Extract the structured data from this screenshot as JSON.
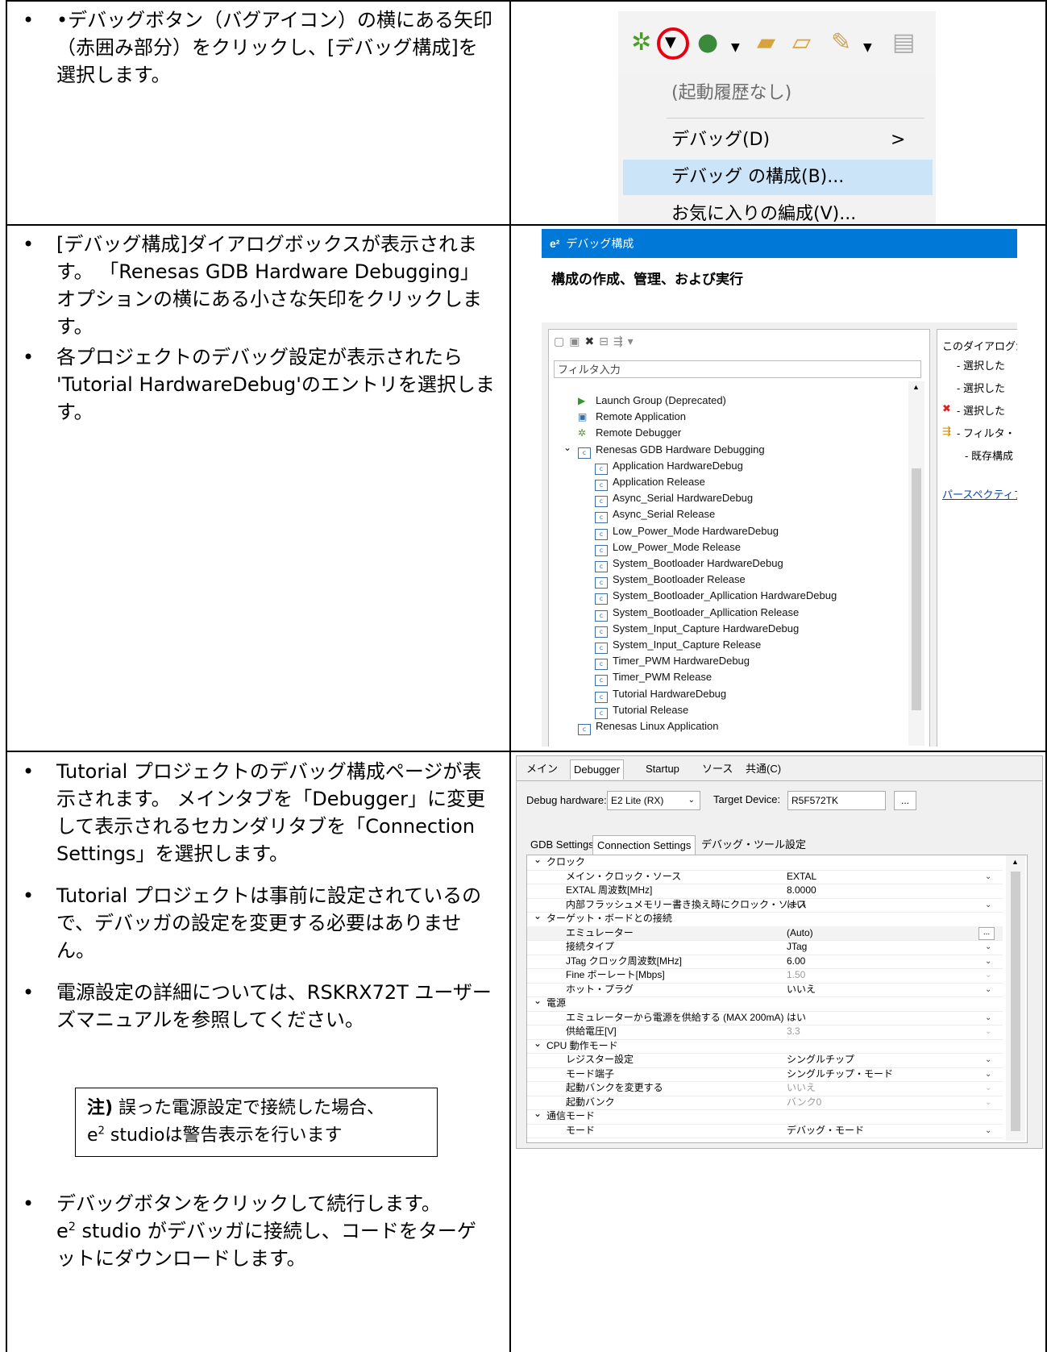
{
  "rows": [
    {
      "bullets": [
        "•デバッグボタン（バグアイコン）の横にある矢印（赤囲み部分）をクリックし、[デバッグ構成]を選択します。"
      ]
    },
    {
      "bullets": [
        "[デバッグ構成]ダイアログボックスが表示されます。 「Renesas GDB Hardware Debugging」オプションの横にある小さな矢印をクリックします。",
        "各プロジェクトのデバッグ設定が表示されたら 'Tutorial HardwareDebug'のエントリを選択します。"
      ]
    },
    {
      "bullets": [
        "Tutorial プロジェクトのデバッグ構成ページが表示されます。 メインタブを「Debugger」に変更して表示されるセカンダリタブを「Connection Settings」を選択します。",
        "Tutorial プロジェクトは事前に設定されているので、デバッガの設定を変更する必要はありません。",
        "電源設定の詳細については、RSKRX72T ユーザーズマニュアルを参照してください。"
      ],
      "note_bold": "注)",
      "note_rest": " 誤った電源設定で接続した場合、",
      "note_line2_pre": "e",
      "note_line2_sup": "2",
      "note_line2_post": " studioは警告表示を行います",
      "last_bullet_line1": "デバッグボタンをクリックして続行します。",
      "last_bullet_pre": "e",
      "last_bullet_sup": "2",
      "last_bullet_post": " studio がデバッガに接続し、コードをターゲットにダウンロードします。"
    }
  ],
  "menu": {
    "items": [
      "(起動履歴なし)",
      "デバッグ(D)",
      "デバッグ の構成(B)...",
      "お気に入りの編成(V)..."
    ],
    "submenu_arrow": ">",
    "highlight_color": "#cce4f7"
  },
  "dialog": {
    "title_prefix": "e²",
    "title": "デバッグ構成",
    "header": "構成の作成、管理、および実行",
    "filter_placeholder": "フィルタ入力",
    "right_pane": [
      "このダイアログか",
      "- 選択した",
      "- 選択した",
      "- 選択した",
      "- フィルタ・",
      "- 既存構成",
      "パースペクティブ"
    ],
    "tree": [
      {
        "label": "Launch Group (Deprecated)",
        "level": 1,
        "icon": "launch-group-icon"
      },
      {
        "label": "Remote Application",
        "level": 1,
        "icon": "remote-app-icon"
      },
      {
        "label": "Remote Debugger",
        "level": 1,
        "icon": "bug-icon"
      },
      {
        "label": "Renesas GDB Hardware Debugging",
        "level": 1,
        "icon": "c-config-icon",
        "expanded": true
      },
      {
        "label": "Application HardwareDebug",
        "level": 2,
        "icon": "c-config-icon"
      },
      {
        "label": "Application Release",
        "level": 2,
        "icon": "c-config-icon"
      },
      {
        "label": "Async_Serial HardwareDebug",
        "level": 2,
        "icon": "c-config-icon"
      },
      {
        "label": "Async_Serial Release",
        "level": 2,
        "icon": "c-config-icon"
      },
      {
        "label": "Low_Power_Mode HardwareDebug",
        "level": 2,
        "icon": "c-config-icon"
      },
      {
        "label": "Low_Power_Mode Release",
        "level": 2,
        "icon": "c-config-icon"
      },
      {
        "label": "System_Bootloader HardwareDebug",
        "level": 2,
        "icon": "c-config-icon"
      },
      {
        "label": "System_Bootloader Release",
        "level": 2,
        "icon": "c-config-icon"
      },
      {
        "label": "System_Bootloader_Apllication HardwareDebug",
        "level": 2,
        "icon": "c-config-icon"
      },
      {
        "label": "System_Bootloader_Apllication Release",
        "level": 2,
        "icon": "c-config-icon"
      },
      {
        "label": "System_Input_Capture HardwareDebug",
        "level": 2,
        "icon": "c-config-icon"
      },
      {
        "label": "System_Input_Capture Release",
        "level": 2,
        "icon": "c-config-icon"
      },
      {
        "label": "Timer_PWM HardwareDebug",
        "level": 2,
        "icon": "c-config-icon"
      },
      {
        "label": "Timer_PWM Release",
        "level": 2,
        "icon": "c-config-icon"
      },
      {
        "label": "Tutorial HardwareDebug",
        "level": 2,
        "icon": "c-config-icon"
      },
      {
        "label": "Tutorial Release",
        "level": 2,
        "icon": "c-config-icon"
      },
      {
        "label": "Renesas Linux Application",
        "level": 1,
        "icon": "c-config-icon"
      }
    ]
  },
  "config": {
    "tabs": [
      "メイン",
      "Debugger",
      "Startup",
      "ソース",
      "共通(C)"
    ],
    "debug_hw_label": "Debug hardware:",
    "debug_hw_value": "E2 Lite (RX)",
    "target_label": "Target Device:",
    "target_value": "R5F572TK",
    "browse": "...",
    "subtabs": [
      "GDB Settings",
      "Connection Settings",
      "デバッグ・ツール設定"
    ],
    "props": [
      {
        "name": "クロック",
        "value": "",
        "group": true
      },
      {
        "name": "メイン・クロック・ソース",
        "value": "EXTAL",
        "dd": true
      },
      {
        "name": "EXTAL 周波数[MHz]",
        "value": "8.0000"
      },
      {
        "name": "内部フラッシュメモリー書き換え時にクロック・ソース",
        "value": "はい",
        "dd": true
      },
      {
        "name": "ターゲット・ボードとの接続",
        "value": "",
        "group": true
      },
      {
        "name": "エミュレーター",
        "value": "(Auto)",
        "btn": true
      },
      {
        "name": "接続タイプ",
        "value": "JTag",
        "dd": true
      },
      {
        "name": "JTag クロック周波数[MHz]",
        "value": "6.00",
        "dd": true
      },
      {
        "name": "Fine ボーレート[Mbps]",
        "value": "1.50",
        "dd": true,
        "dim": true
      },
      {
        "name": "ホット・プラグ",
        "value": "いいえ",
        "dd": true
      },
      {
        "name": "電源",
        "value": "",
        "group": true
      },
      {
        "name": "エミュレーターから電源を供給する (MAX 200mA)",
        "value": "はい",
        "dd": true
      },
      {
        "name": "供給電圧[V]",
        "value": "3.3",
        "dd": true,
        "dim": true
      },
      {
        "name": "CPU 動作モード",
        "value": "",
        "group": true
      },
      {
        "name": "レジスター設定",
        "value": "シングルチップ",
        "dd": true
      },
      {
        "name": "モード端子",
        "value": "シングルチップ・モード",
        "dd": true
      },
      {
        "name": "起動バンクを変更する",
        "value": "いいえ",
        "dd": true,
        "dim": true
      },
      {
        "name": "起動バンク",
        "value": "バンク0",
        "dd": true,
        "dim": true
      },
      {
        "name": "通信モード",
        "value": "",
        "group": true
      },
      {
        "name": "モード",
        "value": "デバッグ・モード",
        "dd": true
      }
    ]
  }
}
